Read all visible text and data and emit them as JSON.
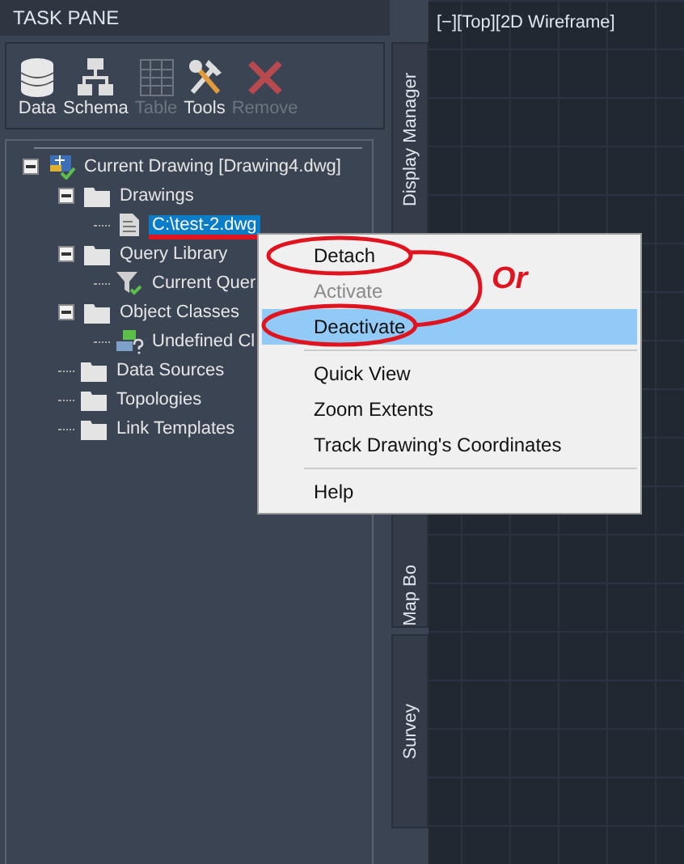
{
  "task_pane": {
    "title": "TASK PANE",
    "toolbar": [
      {
        "label": "Data",
        "kind": "database",
        "disabled": false
      },
      {
        "label": "Schema",
        "kind": "schema",
        "disabled": false
      },
      {
        "label": "Table",
        "kind": "table",
        "disabled": true
      },
      {
        "label": "Tools",
        "kind": "tools",
        "disabled": false
      },
      {
        "label": "Remove",
        "kind": "remove",
        "disabled": true
      }
    ],
    "tree": [
      {
        "label": "Current Drawing [Drawing4.dwg]",
        "kind": "map",
        "expanded": true,
        "selected": false,
        "underlined": false,
        "children": [
          {
            "label": "Drawings",
            "kind": "folder",
            "expanded": true,
            "selected": false,
            "underlined": false,
            "children": [
              {
                "label": "C:\\test-2.dwg",
                "kind": "drawing-file",
                "selected": true,
                "underlined": true
              }
            ]
          },
          {
            "label": "Query Library",
            "kind": "folder",
            "expanded": true,
            "selected": false,
            "underlined": false,
            "children": [
              {
                "label": "Current Quer",
                "kind": "query",
                "selected": false,
                "underlined": false
              }
            ]
          },
          {
            "label": "Object Classes",
            "kind": "folder",
            "expanded": true,
            "selected": false,
            "underlined": false,
            "children": [
              {
                "label": "Undefined Cl",
                "kind": "class",
                "selected": false,
                "underlined": false
              }
            ]
          },
          {
            "label": "Data Sources",
            "kind": "folder",
            "selected": false,
            "underlined": false
          },
          {
            "label": "Topologies",
            "kind": "folder",
            "selected": false,
            "underlined": false
          },
          {
            "label": "Link Templates",
            "kind": "folder",
            "selected": false,
            "underlined": false
          }
        ]
      }
    ]
  },
  "side_tabs": [
    {
      "label": "Display Manager"
    },
    {
      "label": "Map Bo"
    },
    {
      "label": "Survey"
    }
  ],
  "viewport": {
    "label": "[−][Top][2D Wireframe]"
  },
  "context_menu": {
    "items": [
      {
        "kind": "command",
        "label": "Detach",
        "disabled": false,
        "selected": false
      },
      {
        "kind": "command",
        "label": "Activate",
        "disabled": true,
        "selected": false
      },
      {
        "kind": "command",
        "label": "Deactivate",
        "disabled": false,
        "selected": true
      },
      {
        "kind": "separator"
      },
      {
        "kind": "command",
        "label": "Quick View",
        "disabled": false,
        "selected": false
      },
      {
        "kind": "command",
        "label": "Zoom Extents",
        "disabled": false,
        "selected": false
      },
      {
        "kind": "command",
        "label": "Track Drawing's Coordinates",
        "disabled": false,
        "selected": false
      },
      {
        "kind": "separator"
      },
      {
        "kind": "command",
        "label": "Help",
        "disabled": false,
        "selected": false
      }
    ]
  },
  "annotation": {
    "text": "Or"
  }
}
